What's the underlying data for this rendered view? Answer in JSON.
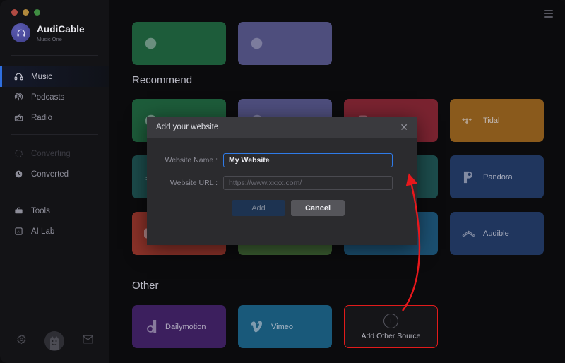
{
  "window": {
    "traffic_lights": [
      "close",
      "minimize",
      "maximize"
    ],
    "menu_icon": "hamburger-menu-icon"
  },
  "sidebar": {
    "brand": {
      "name": "AudiCable",
      "subtitle": "Music One",
      "logo_icon": "headphone-logo-icon"
    },
    "items": [
      {
        "label": "Music",
        "icon": "headphones-icon",
        "active": true,
        "disabled": false
      },
      {
        "label": "Podcasts",
        "icon": "podcast-icon",
        "active": false,
        "disabled": false
      },
      {
        "label": "Radio",
        "icon": "radio-icon",
        "active": false,
        "disabled": false
      },
      {
        "label": "Converting",
        "icon": "spinner-icon",
        "active": false,
        "disabled": true
      },
      {
        "label": "Converted",
        "icon": "clock-icon",
        "active": false,
        "disabled": false
      },
      {
        "label": "Tools",
        "icon": "toolbox-icon",
        "active": false,
        "disabled": false
      },
      {
        "label": "AI Lab",
        "icon": "ai-chip-icon",
        "active": false,
        "disabled": false
      }
    ],
    "bottom_bar": [
      {
        "name": "settings-gear-icon"
      },
      {
        "name": "user-avatar"
      },
      {
        "name": "mail-icon"
      }
    ]
  },
  "main": {
    "sections": [
      {
        "title": "Recommend",
        "cards": [
          {
            "label": "",
            "icon": "spotify-icon",
            "color": "#1d5c3a",
            "visible_label": false
          },
          {
            "label": "",
            "icon": "deezer-icon",
            "color": "#1c4c4c",
            "visible_label": false
          },
          {
            "label": "",
            "icon": "youtube-icon",
            "color": "#8c3229",
            "visible_label": false
          },
          {
            "label": "Tidal",
            "icon": "tidal-icon",
            "color": "#8a5a1c",
            "visible_label": true
          },
          {
            "label": "",
            "icon": "amazon-icon",
            "color": "#4e4e7d",
            "visible_label": false
          },
          {
            "label": "",
            "icon": "apple-music-icon",
            "color": "#7a2330",
            "visible_label": false
          },
          {
            "label": "",
            "icon": "napster-icon",
            "color": "#3b5e31",
            "visible_label": false
          },
          {
            "label": "Pandora",
            "icon": "pandora-icon",
            "color": "#20365e",
            "visible_label": true
          },
          {
            "label": "",
            "icon": "soundcloud-icon",
            "color": "#1b4f70",
            "visible_label": false
          },
          {
            "label": "Audible",
            "icon": "audible-icon",
            "color": "#20365e",
            "visible_label": true
          }
        ]
      },
      {
        "title": "Other",
        "cards": [
          {
            "label": "Dailymotion",
            "icon": "dailymotion-icon",
            "color": "#3c1f5e",
            "visible_label": true
          },
          {
            "label": "Vimeo",
            "icon": "vimeo-icon",
            "color": "#19597a",
            "visible_label": true
          }
        ],
        "add_card": {
          "label": "Add Other Source",
          "icon": "plus-icon",
          "highlight_color": "#e11b1b"
        }
      }
    ]
  },
  "dialog": {
    "title": "Add your website",
    "close_icon": "close-icon",
    "fields": [
      {
        "label": "Website Name :",
        "value": "My Website",
        "placeholder": "",
        "focused": true
      },
      {
        "label": "Website URL :",
        "value": "",
        "placeholder": "https://www.xxxx.com/",
        "focused": false
      }
    ],
    "buttons": [
      {
        "label": "Add",
        "style": "primary"
      },
      {
        "label": "Cancel",
        "style": "secondary"
      }
    ]
  },
  "annotation": {
    "arrow_color": "#e8181c",
    "arrow_from": "add-other-source-card",
    "arrow_to": "website-name-input"
  }
}
